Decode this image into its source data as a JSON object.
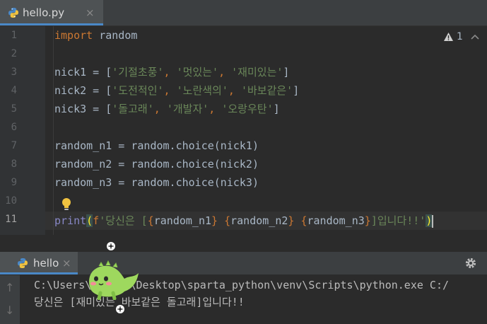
{
  "editor_tab": {
    "filename": "hello.py",
    "close": "×",
    "icon": "python-icon"
  },
  "gutter": {
    "line_numbers": [
      "1",
      "2",
      "3",
      "4",
      "5",
      "6",
      "7",
      "8",
      "9",
      "10",
      "11"
    ],
    "current_line": 11
  },
  "code": {
    "l1_kw": "import",
    "l1_rest": " random",
    "l3_name": "nick1 = [",
    "l3_s1": "'기절초풍'",
    "l3_s2": "'멋있는'",
    "l3_s3": "'재미있는'",
    "l4_name": "nick2 = [",
    "l4_s1": "'도전적인'",
    "l4_s2": "'노란색의'",
    "l4_s3": "'바보같은'",
    "l5_name": "nick3 = [",
    "l5_s1": "'돌고래'",
    "l5_s2": "'개발자'",
    "l5_s3": "'오랑우탄'",
    "sep": ", ",
    "close_bracket": "]",
    "l7": "random_n1 = random.choice(nick1)",
    "l8": "random_n2 = random.choice(nick2)",
    "l9": "random_n3 = random.choice(nick3)",
    "l11_print": "print",
    "l11_open": "(",
    "l11_f": "f",
    "l11_s_a": "'당신은 [",
    "l11_b1o": "{",
    "l11_v1": "random_n1",
    "l11_b1c": "}",
    "l11_sp1": " ",
    "l11_b2o": "{",
    "l11_v2": "random_n2",
    "l11_b2c": "}",
    "l11_sp2": " ",
    "l11_b3o": "{",
    "l11_v3": "random_n3",
    "l11_b3c": "}",
    "l11_s_b": "]입니다!!'",
    "l11_close": ")"
  },
  "inspections": {
    "warning_count": "1",
    "icon": "warning-icon"
  },
  "run_panel": {
    "tab_label": "hello",
    "close": "×",
    "icon": "python-icon",
    "settings_icon": "gear-icon"
  },
  "console": {
    "line1": "C:\\Users\\      \\Desktop\\sparta_python\\venv\\Scripts\\python.exe C:/",
    "line2": "당신은 [재미있는 바보같은 돌고래]입니다!!"
  },
  "colors": {
    "keyword": "#cc7832",
    "string": "#6a8759",
    "builtin": "#8888c6",
    "text": "#a9b7c6",
    "tab_accent": "#4a88c7"
  }
}
